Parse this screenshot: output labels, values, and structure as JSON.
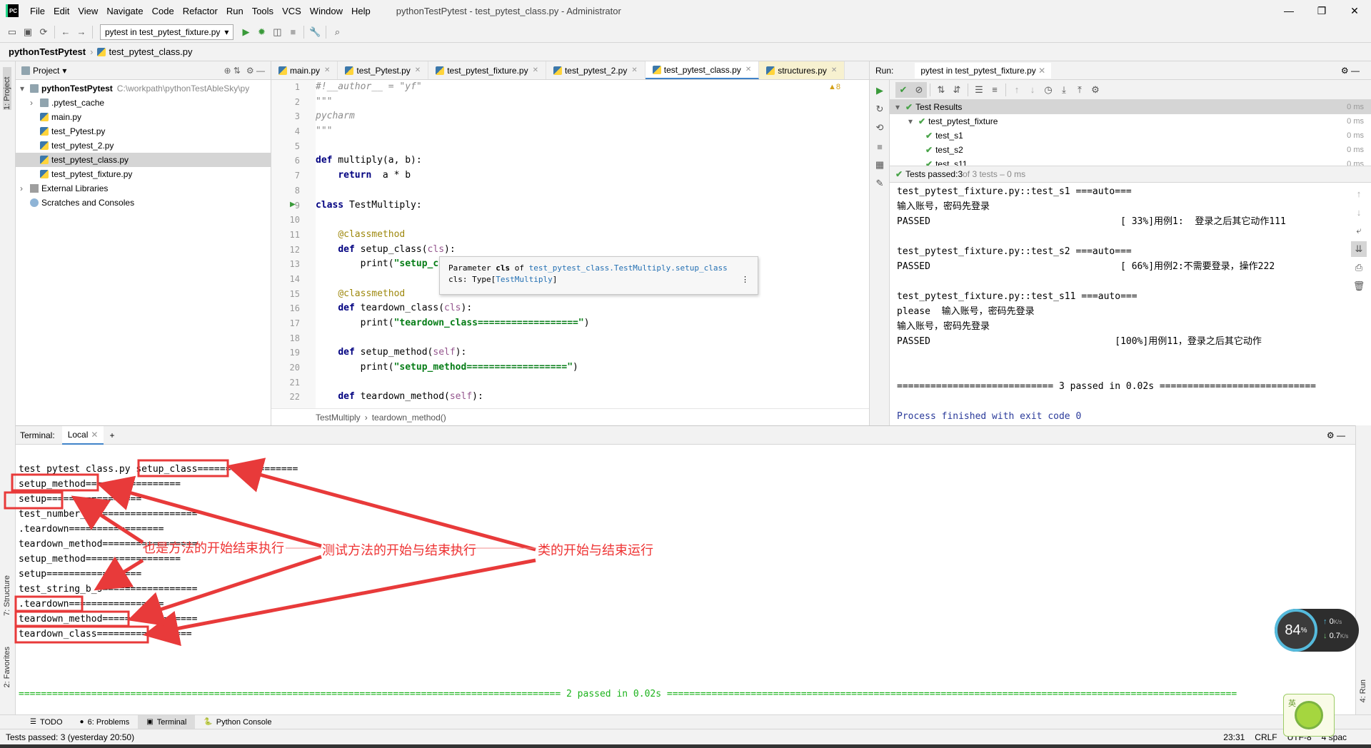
{
  "menu": [
    "File",
    "Edit",
    "View",
    "Navigate",
    "Code",
    "Refactor",
    "Run",
    "Tools",
    "VCS",
    "Window",
    "Help"
  ],
  "window_title": "pythonTestPytest - test_pytest_class.py - Administrator",
  "toolbar": {
    "run_config": "pytest in test_pytest_fixture.py"
  },
  "breadcrumb": {
    "project": "pythonTestPytest",
    "file": "test_pytest_class.py"
  },
  "left_strip": {
    "project_label": "1: Project",
    "structure_label": "7: Structure",
    "favorites_label": "2: Favorites"
  },
  "project": {
    "header": "Project",
    "root": "pythonTestPytest",
    "root_path": "C:\\workpath\\pythonTestAbleSky\\py",
    "items": [
      {
        "label": ".pytest_cache",
        "kind": "folder"
      },
      {
        "label": "main.py",
        "kind": "py"
      },
      {
        "label": "test_Pytest.py",
        "kind": "py"
      },
      {
        "label": "test_pytest_2.py",
        "kind": "py"
      },
      {
        "label": "test_pytest_class.py",
        "kind": "py"
      },
      {
        "label": "test_pytest_fixture.py",
        "kind": "py"
      }
    ],
    "external": "External Libraries",
    "scratches": "Scratches and Consoles"
  },
  "editor": {
    "tabs": [
      "main.py",
      "test_Pytest.py",
      "test_pytest_fixture.py",
      "test_pytest_2.py",
      "test_pytest_class.py",
      "structures.py"
    ],
    "active_tab": 4,
    "warnings": "▲8",
    "line_numbers": [
      "1",
      "2",
      "3",
      "4",
      "5",
      "6",
      "7",
      "8",
      "9",
      "10",
      "11",
      "12",
      "13",
      "14",
      "15",
      "16",
      "17",
      "18",
      "19",
      "20",
      "21",
      "22"
    ],
    "tooltip": {
      "line1_a": "Parameter ",
      "line1_b": "cls",
      "line1_c": " of ",
      "line1_link": "test_pytest_class.TestMultiply.setup_class",
      "line2_a": "cls: Type[",
      "line2_link": "TestMultiply",
      "line2_b": "]"
    },
    "crumb1": "TestMultiply",
    "crumb2": "teardown_method()"
  },
  "run": {
    "label": "Run:",
    "tab": "pytest in test_pytest_fixture.py",
    "tree": [
      {
        "label": "Test Results",
        "time": "0 ms"
      },
      {
        "label": "test_pytest_fixture",
        "time": "0 ms"
      },
      {
        "label": "test_s1",
        "time": "0 ms"
      },
      {
        "label": "test_s2",
        "time": "0 ms"
      },
      {
        "label": "test_s11",
        "time": "0 ms"
      }
    ],
    "status_a": "Tests passed: ",
    "status_b": "3",
    "status_c": " of 3 tests – 0 ms",
    "output": [
      "test_pytest_fixture.py::test_s1 ===auto===",
      "输入账号，密码先登录",
      "PASSED                                  [ 33%]用例1:  登录之后其它动作111",
      "",
      "test_pytest_fixture.py::test_s2 ===auto===",
      "PASSED                                  [ 66%]用例2:不需要登录，操作222",
      "",
      "test_pytest_fixture.py::test_s11 ===auto===",
      "please  输入账号，密码先登录",
      "输入账号，密码先登录",
      "PASSED                                 [100%]用例11，登录之后其它动作",
      "",
      "",
      "============================ 3 passed in 0.02s ============================",
      "",
      "Process finished with exit code 0"
    ]
  },
  "terminal": {
    "label": "Terminal:",
    "tab": "Local",
    "lines": [
      "test_pytest_class.py setup_class==================",
      "setup_method=================",
      "setup=================",
      "test_number_3_5=================",
      ".teardown=================",
      "teardown_method=================",
      "setup_method=================",
      "setup=================",
      "test_string_b_s=================",
      ".teardown=================",
      "teardown_method=================",
      "teardown_class=================",
      "",
      "",
      "",
      "================================================================================================= 2 passed in 0.02s ======================================================================================================"
    ]
  },
  "annotations": {
    "a1": "也是方法的开始结束执行",
    "a2": "测试方法的开始与结束执行",
    "a3": "类的开始与结束运行",
    "accent": "#e83a3a"
  },
  "bottom_tabs": [
    "TODO",
    "6: Problems",
    "Terminal",
    "Python Console"
  ],
  "status": {
    "left": "Tests passed: 3 (yesterday 20:50)",
    "pos": "23:31",
    "eol": "CRLF",
    "enc": "UTF-8",
    "indent": "4 spac"
  },
  "widget": {
    "percent": "84",
    "unit": "%",
    "up": "0",
    "up_unit": "K/s",
    "down": "0.7",
    "down_unit": "K/s"
  },
  "run_side_label": "4: Run",
  "logo_text": "英"
}
